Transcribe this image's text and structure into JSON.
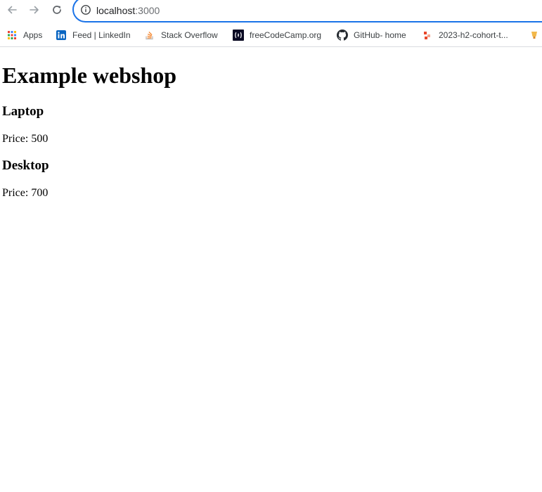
{
  "browser": {
    "address_host": "localhost",
    "address_port": ":3000",
    "bookmarks": [
      {
        "label": "Apps",
        "icon": "apps-grid-icon"
      },
      {
        "label": "Feed | LinkedIn",
        "icon": "linkedin-icon"
      },
      {
        "label": "Stack Overflow",
        "icon": "stackoverflow-icon"
      },
      {
        "label": "freeCodeCamp.org",
        "icon": "freecodecamp-icon"
      },
      {
        "label": "GitHub- home",
        "icon": "github-icon"
      },
      {
        "label": "2023-h2-cohort-t...",
        "icon": "cohort-icon"
      },
      {
        "label": "",
        "icon": "bookmark-extra-icon"
      }
    ]
  },
  "page": {
    "title": "Example webshop",
    "products": [
      {
        "name": "Laptop",
        "price_text": "Price: 500"
      },
      {
        "name": "Desktop",
        "price_text": "Price: 700"
      }
    ]
  },
  "colors": {
    "omnibox_border": "#1a73e8",
    "linkedin": "#0a66c2",
    "stackoverflow": "#f48024",
    "cohort": "#e8462b"
  }
}
